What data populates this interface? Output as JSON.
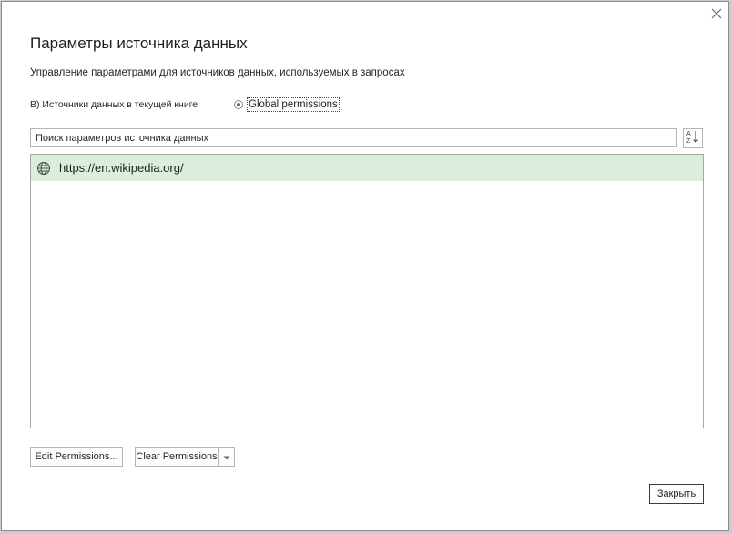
{
  "dialog": {
    "title": "Параметры источника данных",
    "subtitle": "Управление параметрами для источников данных, используемых в запросах",
    "close_icon": "close-icon"
  },
  "scope": {
    "current_workbook_label": "В) Источники данных в текущей книге",
    "global_permissions_label": "Global permissions",
    "global_selected": true
  },
  "search": {
    "placeholder": "Поиск параметров источника данных",
    "sort_icon": "sort-az-icon"
  },
  "sources": [
    {
      "icon": "globe-icon",
      "url": "https://en.wikipedia.org/",
      "selected": true
    }
  ],
  "buttons": {
    "edit_permissions": "Edit Permissions...",
    "clear_permissions": "Clear Permissions",
    "close": "Закрыть"
  },
  "colors": {
    "selection": "#dbeedd",
    "border": "#b5b5b5",
    "text": "#1f1f1f"
  }
}
